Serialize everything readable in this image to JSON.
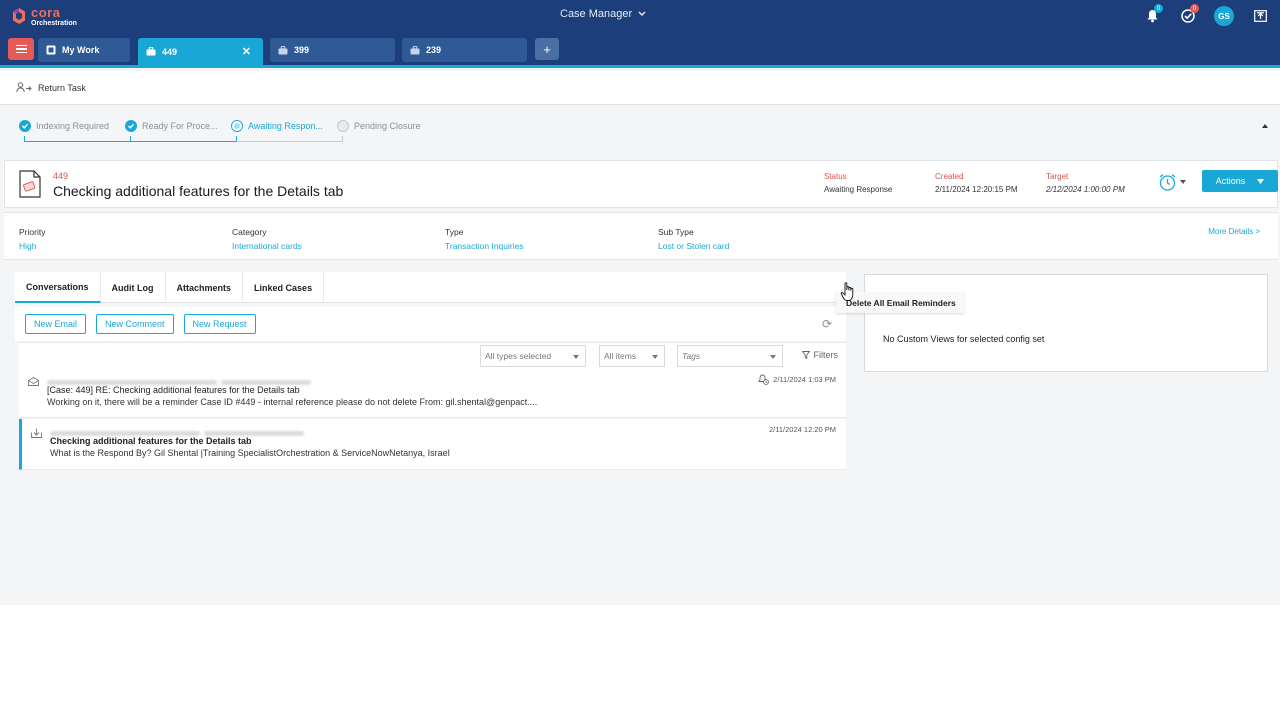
{
  "app": {
    "logo_top": "cora",
    "logo_bottom": "Orchestration",
    "title": "Case Manager",
    "badges": {
      "notifications": "0",
      "tasks": "0"
    },
    "avatar_initials": "GS"
  },
  "tabs": [
    {
      "label": "My Work"
    },
    {
      "label": "449",
      "active": true
    },
    {
      "label": "399"
    },
    {
      "label": "239"
    }
  ],
  "add_tab": "+",
  "return_task": "Return Task",
  "stepper": [
    {
      "label": "Indexing Required",
      "state": "done"
    },
    {
      "label": "Ready For Proce...",
      "state": "done"
    },
    {
      "label": "Awaiting Respon...",
      "state": "current"
    },
    {
      "label": "Pending Closure",
      "state": "pending"
    }
  ],
  "case": {
    "number": "449",
    "title": "Checking additional features for the Details tab",
    "status_label": "Status",
    "status_value": "Awaiting Response",
    "created_label": "Created",
    "created_value": "2/11/2024 12:20:15 PM",
    "target_label": "Target",
    "target_value": "2/12/2024 1:00:00 PM",
    "actions_label": "Actions"
  },
  "details": {
    "priority_label": "Priority",
    "priority_value": "High",
    "category_label": "Category",
    "category_value": "International cards",
    "type_label": "Type",
    "type_value": "Transaction Inquiries",
    "subtype_label": "Sub Type",
    "subtype_value": "Lost or Stolen card",
    "more": "More Details >"
  },
  "panel_tabs": [
    "Conversations",
    "Audit Log",
    "Attachments",
    "Linked Cases"
  ],
  "buttons": {
    "new_email": "New Email",
    "new_comment": "New Comment",
    "new_request": "New Request"
  },
  "filters": {
    "types": "All types selected",
    "items": "All items",
    "tags_placeholder": "Tags",
    "filters_label": "Filters"
  },
  "messages": [
    {
      "subject": "[Case: 449] RE: Checking additional features for the Details tab",
      "preview": "Working on it, there will be a reminder Case ID #449 - internal reference please do not delete From: gil.shental@genpact....",
      "time": "2/11/2024 1:03 PM"
    },
    {
      "subject": "Checking additional features for the Details tab",
      "preview": "What is the Respond By?  Gil Shental |Training SpecialistOrchestration & ServiceNowNetanya, Israel",
      "time": "2/11/2024 12:20 PM"
    }
  ],
  "right_panel": {
    "empty_text": "No Custom Views for selected config set"
  },
  "tooltip": "Delete All Email Reminders",
  "colors": {
    "navy": "#1c3f7c",
    "accent": "#19a7d6",
    "red": "#e45a57"
  }
}
